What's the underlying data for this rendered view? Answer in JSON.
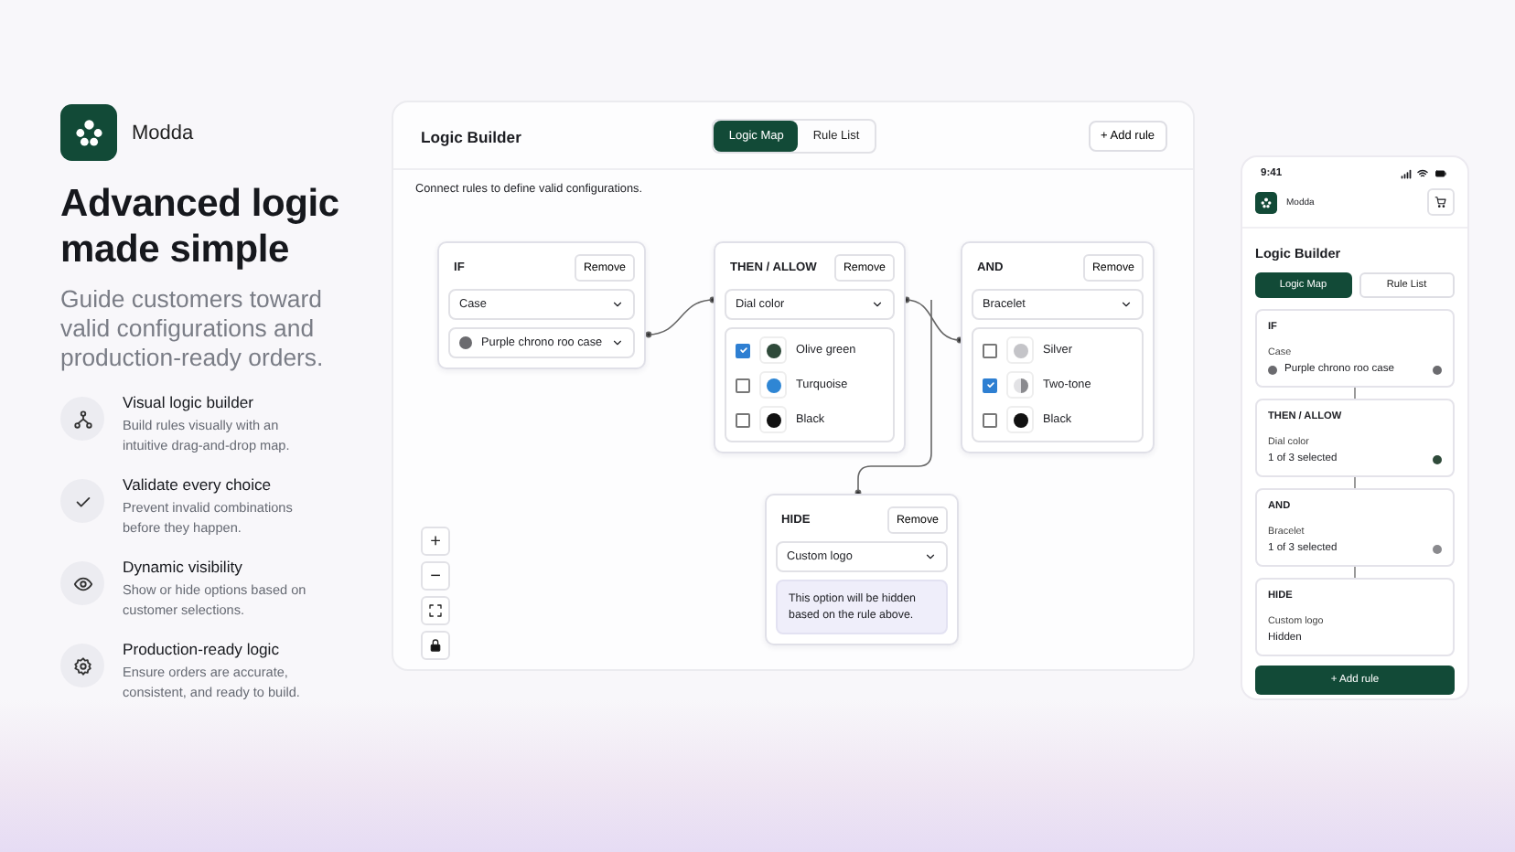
{
  "intro": {
    "brand": "Modda",
    "heading": "Advanced logic made simple",
    "subtitle": "Guide customers toward valid configurations and production-ready orders.",
    "features": [
      {
        "kind": "flow",
        "title": "Visual logic builder",
        "description": "Build rules visually with an intuitive drag-and-drop map."
      },
      {
        "kind": "check",
        "title": "Validate every choice",
        "description": "Prevent invalid combinations before they happen."
      },
      {
        "kind": "eye",
        "title": "Dynamic visibility",
        "description": "Show or hide options based on customer selections."
      },
      {
        "kind": "gear",
        "title": "Production-ready logic",
        "description": "Ensure orders are accurate, consistent, and ready to build."
      }
    ]
  },
  "board": {
    "title": "Logic Builder",
    "tabs": [
      {
        "label": "Logic Map",
        "selected": true
      },
      {
        "label": "Rule List",
        "selected": false
      }
    ],
    "add_button": "+ Add rule",
    "hint": "Connect rules to define valid configurations.",
    "nodes": [
      {
        "heading": "IF",
        "remove": "Remove",
        "select": "Case",
        "value": {
          "label": "Purple chrono roo case",
          "color": "#6b6b6f"
        }
      },
      {
        "heading": "THEN / ALLOW",
        "remove": "Remove",
        "select": "Dial color",
        "options": [
          {
            "label": "Olive green",
            "checked": true,
            "color": "#2f4a3a",
            "kind": "solid"
          },
          {
            "label": "Turquoise",
            "checked": false,
            "color": "#2f86d4",
            "kind": "solid"
          },
          {
            "label": "Black",
            "checked": false,
            "color": "#111111",
            "kind": "solid"
          }
        ]
      },
      {
        "heading": "AND",
        "remove": "Remove",
        "select": "Bracelet",
        "options": [
          {
            "label": "Silver",
            "checked": false,
            "color": "#c4c4c8",
            "kind": "solid"
          },
          {
            "label": "Two-tone",
            "checked": true,
            "color": "#8a8a8e",
            "kind": "split"
          },
          {
            "label": "Black",
            "checked": false,
            "color": "#111111",
            "kind": "solid"
          }
        ]
      },
      {
        "heading": "HIDE",
        "remove": "Remove",
        "select": "Custom logo",
        "note": "This option will be hidden based on the rule above."
      }
    ],
    "zoom_controls": [
      "+",
      "−"
    ]
  },
  "phone": {
    "time": "9:41",
    "brand": "Modda",
    "title": "Logic Builder",
    "tabs": [
      {
        "label": "Logic Map",
        "selected": true
      },
      {
        "label": "Rule List",
        "selected": false
      }
    ],
    "cards": [
      {
        "heading": "IF",
        "field": "Case",
        "value": "Purple chrono roo case",
        "color": "#6b6b6f",
        "lead_dot": true
      },
      {
        "heading": "THEN / ALLOW",
        "field": "Dial color",
        "value": "1 of 3 selected",
        "color": "#2f4a3a",
        "lead_dot": false
      },
      {
        "heading": "AND",
        "field": "Bracelet",
        "value": "1 of 3 selected",
        "color": "#8a8a8e",
        "lead_dot": false
      },
      {
        "heading": "HIDE",
        "field": "Custom logo",
        "value": "Hidden",
        "lead_dot": false
      }
    ],
    "add_button": "+ Add rule"
  }
}
